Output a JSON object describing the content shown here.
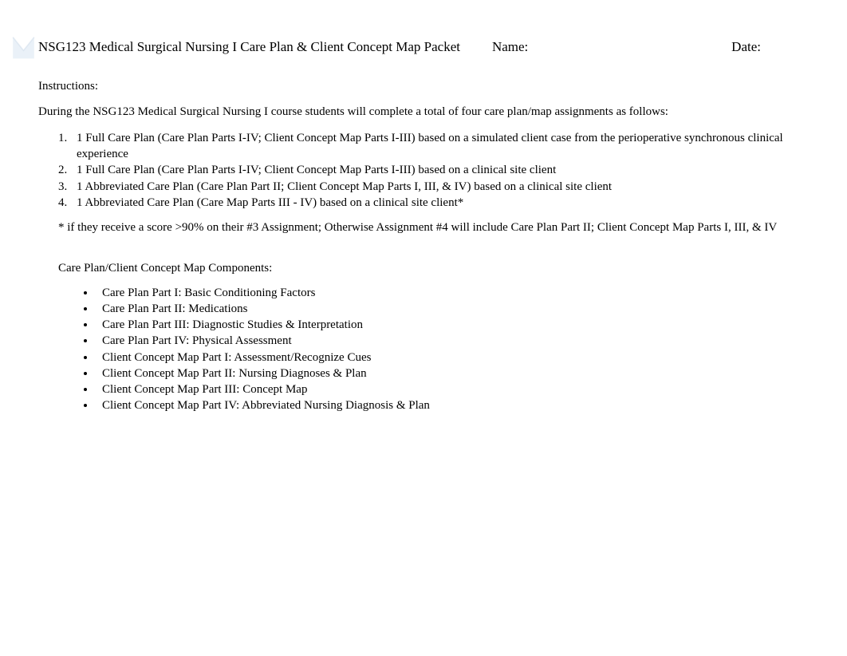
{
  "header": {
    "title": "NSG123 Medical Surgical Nursing I Care Plan & Client Concept Map Packet",
    "name_label": "Name:",
    "date_label": "Date:"
  },
  "instructions_label": "Instructions:",
  "intro": "During the NSG123 Medical Surgical Nursing I course students will complete a total of four care plan/map assignments as follows:",
  "assignments": [
    "1 Full Care Plan (Care Plan Parts I-IV; Client Concept Map Parts I-III) based on a simulated client case from the perioperative synchronous clinical experience",
    "1 Full Care Plan (Care Plan Parts I-IV; Client Concept Map Parts I-III) based on a clinical site client",
    "1 Abbreviated Care Plan (Care Plan Part II; Client Concept Map Parts I, III, & IV) based on a clinical site client",
    "1 Abbreviated Care Plan (Care Map Parts III - IV) based on a clinical site client*"
  ],
  "footnote": "* if they receive a score >90% on their #3 Assignment; Otherwise Assignment #4 will include Care Plan Part II; Client Concept Map Parts I, III, & IV",
  "components_label": "Care Plan/Client Concept Map Components:",
  "components": [
    "Care Plan Part I: Basic Conditioning Factors",
    "Care Plan Part II: Medications",
    "Care Plan Part III: Diagnostic Studies & Interpretation",
    "Care Plan Part IV: Physical Assessment",
    "Client Concept Map Part I: Assessment/Recognize Cues",
    "Client Concept Map Part II: Nursing Diagnoses & Plan",
    "Client Concept Map Part III: Concept Map",
    "Client Concept Map Part IV: Abbreviated Nursing Diagnosis & Plan"
  ]
}
